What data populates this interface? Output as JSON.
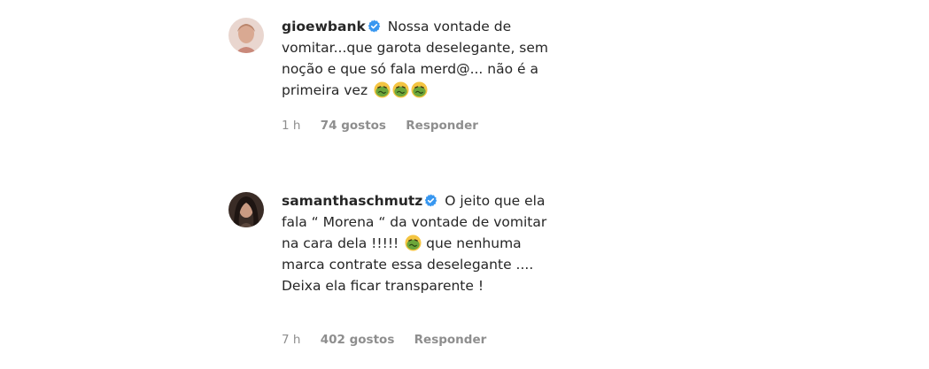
{
  "comments": [
    {
      "username": "gioewbank",
      "verified": true,
      "avatar_icon": "profile-photo",
      "text_before_emoji": "Nossa vontade de vomitar...que garota deselegante, sem noção e que só fala merd@... não é a primeira vez",
      "emoji_name": "nauseated-face-icon",
      "time": "1 h",
      "likes": "74 gostos",
      "reply_label": "Responder"
    },
    {
      "username": "samanthaschmutz",
      "verified": true,
      "avatar_icon": "profile-photo",
      "text_before_emoji": "O jeito que ela fala “ Morena “ da vontade de vomitar na cara dela !!!!!",
      "text_after_emoji": "que nenhuma marca contrate essa deselegante .... Deixa ela ficar transparente !",
      "emoji_name": "nauseated-face-icon",
      "time": "7 h",
      "likes": "402 gostos",
      "reply_label": "Responder"
    }
  ],
  "colors": {
    "text": "#262626",
    "meta": "#8e8e8e",
    "verified": "#3897f0",
    "emoji_face": "#f4c542",
    "emoji_nausea": "#6ca63a"
  }
}
